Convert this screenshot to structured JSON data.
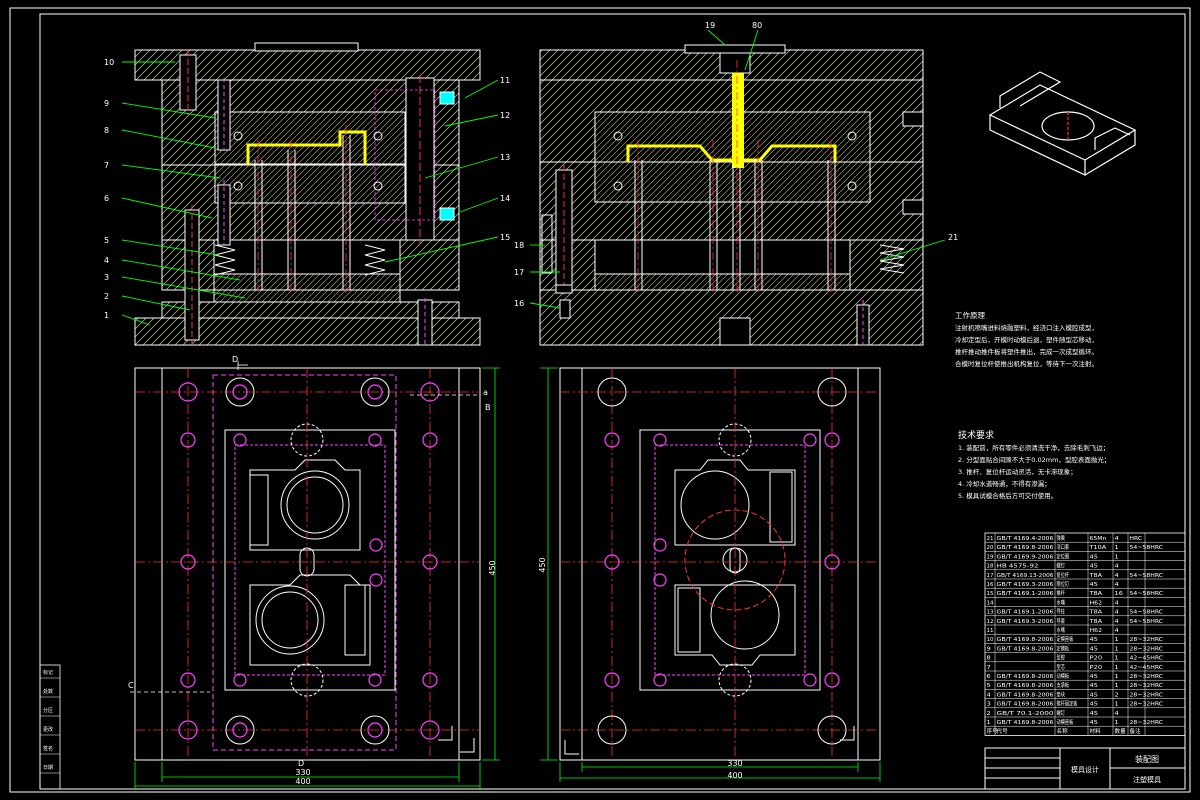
{
  "callouts_left": [
    "10",
    "9",
    "8",
    "7",
    "6",
    "5",
    "4",
    "3",
    "2",
    "1"
  ],
  "callouts_right": [
    "11",
    "12",
    "13",
    "14",
    "15"
  ],
  "callouts_mid": [
    "19",
    "80",
    "18",
    "17",
    "16",
    "21"
  ],
  "dims": {
    "left_width_inner": "330",
    "left_width_outer": "400",
    "left_height": "450",
    "right_width_inner": "330",
    "right_width_outer": "400",
    "right_height": "450"
  },
  "section_marks": {
    "a": "a",
    "d_top": "D",
    "d_bottom": "D",
    "b": "B",
    "c": "C"
  },
  "notes": {
    "work_title": "工作原理",
    "work_lines": [
      "注射机喷嘴进料熔融塑料，经浇口注入模腔成型，",
      "冷却定型后，开模时动模后退，塑件随型芯移动，",
      "推杆推动推件板将塑件推出，完成一次成型循环。",
      "合模时复位杆使推出机构复位，等待下一次注射。"
    ],
    "tech_title": "技术要求",
    "tech_lines": [
      "1. 装配前，所有零件必须清洗干净，去除毛刺飞边；",
      "2. 分型面贴合间隙不大于0.02mm，型腔表面抛光；",
      "3. 推杆、复位杆运动灵活，无卡滞现象；",
      "4. 冷却水道畅通，不得有渗漏；",
      "5. 模具试模合格后方可交付使用。"
    ]
  },
  "bom_rows": [
    [
      "21",
      "GB/T 4169.4-2006",
      "弹簧",
      "65Mn",
      "4",
      "HRC"
    ],
    [
      "20",
      "GB/T 4169.8-2006",
      "浇口套",
      "T10A",
      "1",
      "54~58HRC"
    ],
    [
      "19",
      "GB/T 4169.9-2006",
      "定位圈",
      "45",
      "1",
      ""
    ],
    [
      "18",
      "HB 4575-92",
      "螺钉",
      "45",
      "4",
      ""
    ],
    [
      "17",
      "GB/T 4169.13-2006",
      "复位杆",
      "T8A",
      "4",
      "54~58HRC"
    ],
    [
      "16",
      "GB/T 4169.3-2006",
      "限位钉",
      "45",
      "4",
      ""
    ],
    [
      "15",
      "GB/T 4169.1-2006",
      "推杆",
      "T8A",
      "16",
      "54~58HRC"
    ],
    [
      "14",
      "",
      "水嘴",
      "H62",
      "4",
      ""
    ],
    [
      "13",
      "GB/T 4169.1-2006",
      "导柱",
      "T8A",
      "4",
      "54~58HRC"
    ],
    [
      "12",
      "GB/T 4169.3-2006",
      "导套",
      "T8A",
      "4",
      "54~58HRC"
    ],
    [
      "11",
      "",
      "水嘴",
      "H62",
      "4",
      ""
    ],
    [
      "10",
      "GB/T 4169.8-2006",
      "定模座板",
      "45",
      "1",
      "28~32HRC"
    ],
    [
      "9",
      "GB/T 4169.8-2006",
      "定模板",
      "45",
      "1",
      "28~32HRC"
    ],
    [
      "8",
      "",
      "型腔",
      "P20",
      "1",
      "42~45HRC"
    ],
    [
      "7",
      "",
      "型芯",
      "P20",
      "1",
      "42~45HRC"
    ],
    [
      "6",
      "GB/T 4169.8-2006",
      "动模板",
      "45",
      "1",
      "28~32HRC"
    ],
    [
      "5",
      "GB/T 4169.8-2006",
      "支承板",
      "45",
      "1",
      "28~32HRC"
    ],
    [
      "4",
      "GB/T 4169.8-2006",
      "垫块",
      "45",
      "2",
      "28~32HRC"
    ],
    [
      "3",
      "GB/T 4169.8-2006",
      "推杆固定板",
      "45",
      "1",
      "28~32HRC"
    ],
    [
      "2",
      "GB/T 70.1-2000",
      "螺钉",
      "45",
      "4",
      ""
    ],
    [
      "1",
      "GB/T 4169.8-2006",
      "动模座板",
      "45",
      "1",
      "28~32HRC"
    ]
  ],
  "bom_header": [
    "序号",
    "代号",
    "名称",
    "材料",
    "数量",
    "备注"
  ],
  "title_block": {
    "name": "装配图",
    "sub": "注塑模具",
    "company": "模具设计"
  },
  "left_box_labels": [
    "标记",
    "处数",
    "分区",
    "更改",
    "签名",
    "日期"
  ]
}
